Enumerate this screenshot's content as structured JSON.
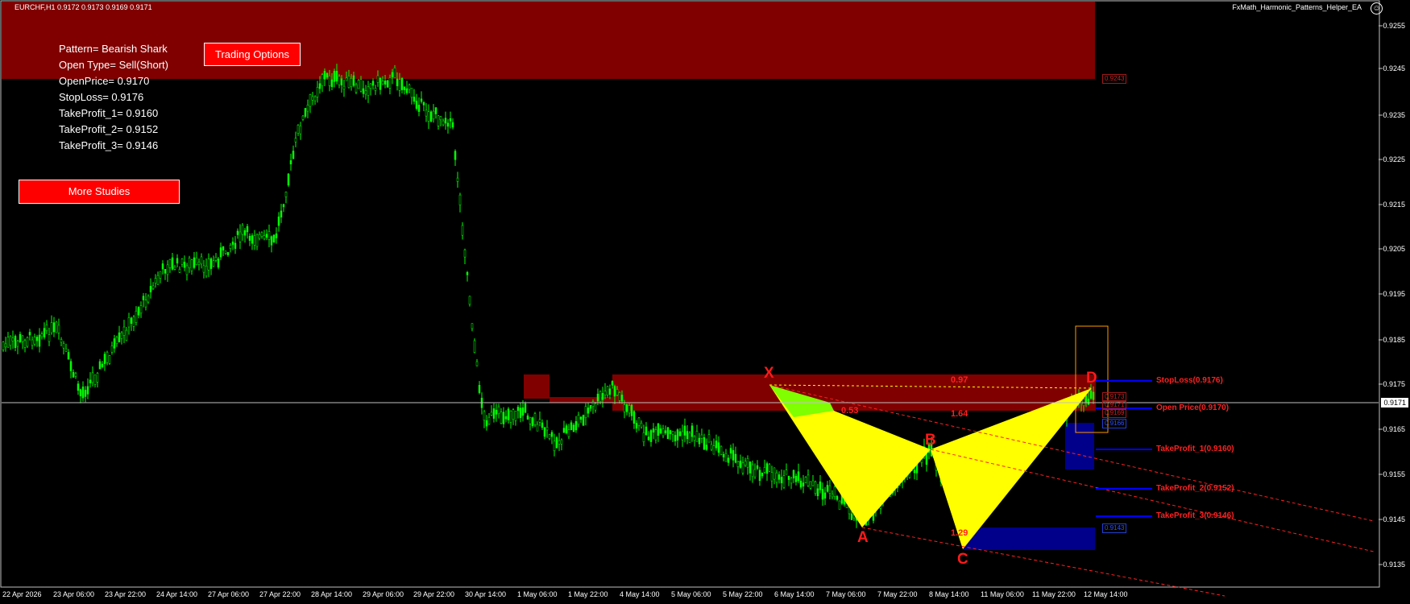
{
  "header": {
    "symbol": "EURCHF,H1  0.9172 0.9173 0.9169 0.9171",
    "ea_name": "FxMath_Harmonic_Patterns_Helper_EA",
    "ea_icon": "smiley-icon"
  },
  "info_panel": {
    "pattern": "Pattern= Bearish Shark",
    "open_type": "Open Type= Sell(Short)",
    "open_price": "OpenPrice= 0.9170",
    "stop_loss": "StopLoss= 0.9176",
    "take_profit_1": "TakeProfit_1= 0.9160",
    "take_profit_2": "TakeProfit_2= 0.9152",
    "take_profit_3": "TakeProfit_3= 0.9146"
  },
  "buttons": {
    "trading_options": "Trading Options",
    "more_studies": "More Studies"
  },
  "price_axis": [
    "0.9255",
    "0.9245",
    "0.9235",
    "0.9225",
    "0.9215",
    "0.9205",
    "0.9195",
    "0.9185",
    "0.9175",
    "0.9165",
    "0.9155",
    "0.9145",
    "0.9135"
  ],
  "current_price": "0.9171",
  "time_axis": [
    "22 Apr 2026",
    "23 Apr 06:00",
    "23 Apr 22:00",
    "24 Apr 14:00",
    "27 Apr 06:00",
    "27 Apr 22:00",
    "28 Apr 14:00",
    "29 Apr 06:00",
    "29 Apr 22:00",
    "30 Apr 14:00",
    "1 May 06:00",
    "1 May 22:00",
    "4 May 14:00",
    "5 May 06:00",
    "5 May 22:00",
    "6 May 14:00",
    "7 May 06:00",
    "7 May 22:00",
    "8 May 14:00",
    "11 May 06:00",
    "11 May 22:00",
    "12 May 14:00"
  ],
  "pattern_points": {
    "x": "X",
    "a": "A",
    "b": "B",
    "c": "C",
    "d": "D"
  },
  "ratios": {
    "xb": "0.53",
    "ac": "1.64",
    "bd": "1.29",
    "xd": "0.97"
  },
  "levels": {
    "stop_loss": "StopLoss(0.9176)",
    "open_price": "Open Price(0.9170)",
    "tp1": "TakeProfit_1(0.9160)",
    "tp2": "TakeProfit_2(0.9152)",
    "tp3": "TakeProfit_3(0.9146)"
  },
  "price_tags": {
    "zone_top": "0.9243",
    "near_d_1": "0.9173",
    "near_d_2": "0.9171",
    "near_d_3": "0.9169",
    "near_d_4": "0.9166",
    "lower_blue": "0.9143"
  },
  "colors": {
    "background": "#000000",
    "bull_candle": "#00ff00",
    "zone_red": "#800000",
    "pattern_fill": "#ffff00",
    "buy_zone": "#00008b",
    "level_line": "#0000ff",
    "label_red": "#ff2020",
    "button_red": "#ff0000"
  }
}
